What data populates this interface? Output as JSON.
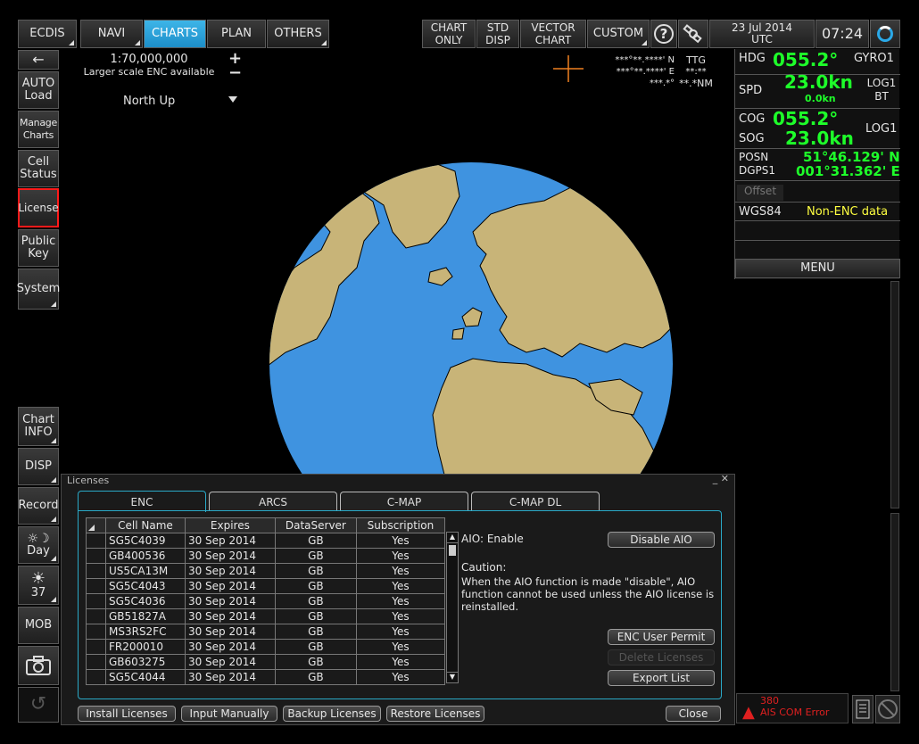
{
  "top": {
    "ecdis": "ECDIS",
    "navi": "NAVI",
    "charts": "CHARTS",
    "plan": "PLAN",
    "others": "OTHERS",
    "chart_only": "CHART ONLY",
    "std_disp": "STD DISP",
    "vector_chart": "VECTOR CHART",
    "custom": "CUSTOM",
    "help": "?",
    "date": "23 Jul 2014",
    "tz": "UTC",
    "time": "07:24"
  },
  "side": {
    "back": "←",
    "auto_load": "AUTO Load",
    "manage_charts": "Manage Charts",
    "cell_status": "Cell Status",
    "license": "License",
    "public_key": "Public Key",
    "system": "System",
    "chart_info": "Chart INFO",
    "disp": "DISP",
    "record": "Record",
    "day": "Day",
    "brightness": "37",
    "mob": "MOB"
  },
  "chart": {
    "scale": "1:70,000,000",
    "larger_scale": "Larger scale ENC available",
    "north_up": "North Up",
    "plus": "+",
    "minus": "−",
    "cursor_lat": "***°**.****' N",
    "cursor_lon": "***°**.****' E",
    "cursor_dist": "***.*°",
    "ttg_label": "TTG",
    "ttg_val": "**:**",
    "nm": "**.*NM"
  },
  "nav": {
    "hdg_label": "HDG",
    "hdg": "055.2°",
    "gyro": "GYRO1",
    "spd_label": "SPD",
    "spd": "23.0kn",
    "spd_sub": "0.0kn",
    "log1bt": "LOG1 BT",
    "cog_label": "COG",
    "cog": "055.2°",
    "sog_label": "SOG",
    "sog": "23.0kn",
    "log1": "LOG1",
    "posn_label": "POSN",
    "dgps": "DGPS1",
    "lat": "51°46.129' N",
    "lon": "001°31.362' E",
    "offset": "Offset",
    "datum": "WGS84",
    "non_enc": "Non-ENC data",
    "menu": "MENU"
  },
  "licenses": {
    "title": "Licenses",
    "tabs": [
      "ENC",
      "ARCS",
      "C-MAP",
      "C-MAP DL"
    ],
    "columns": [
      "Cell Name",
      "Expires",
      "DataServer",
      "Subscription"
    ],
    "rows": [
      [
        "SG5C4039",
        "30 Sep 2014",
        "GB",
        "Yes"
      ],
      [
        "GB400536",
        "30 Sep 2014",
        "GB",
        "Yes"
      ],
      [
        "US5CA13M",
        "30 Sep 2014",
        "GB",
        "Yes"
      ],
      [
        "SG5C4043",
        "30 Sep 2014",
        "GB",
        "Yes"
      ],
      [
        "SG5C4036",
        "30 Sep 2014",
        "GB",
        "Yes"
      ],
      [
        "GB51827A",
        "30 Sep 2014",
        "GB",
        "Yes"
      ],
      [
        "MS3RS2FC",
        "30 Sep 2014",
        "GB",
        "Yes"
      ],
      [
        "FR200010",
        "30 Sep 2014",
        "GB",
        "Yes"
      ],
      [
        "GB603275",
        "30 Sep 2014",
        "GB",
        "Yes"
      ],
      [
        "SG5C4044",
        "30 Sep 2014",
        "GB",
        "Yes"
      ]
    ],
    "aio_status": "AIO:  Enable",
    "disable_aio": "Disable AIO",
    "caution_title": "Caution:",
    "caution_text": "When the AIO function is made \"disable\", AIO function cannot be used unless the AIO license is reinstalled.",
    "enc_user_permit": "ENC User Permit",
    "delete_licenses": "Delete Licenses",
    "export_list": "Export List",
    "install": "Install Licenses",
    "input_manually": "Input Manually",
    "backup": "Backup Licenses",
    "restore": "Restore Licenses",
    "close": "Close"
  },
  "alert": {
    "code": "380",
    "text": "AIS COM Error"
  },
  "colors": {
    "accent": "#1c9ed8",
    "land": "#c8b478",
    "sea": "#3f93e0",
    "value_green": "#1eff2a",
    "alert_red": "#e02020"
  }
}
